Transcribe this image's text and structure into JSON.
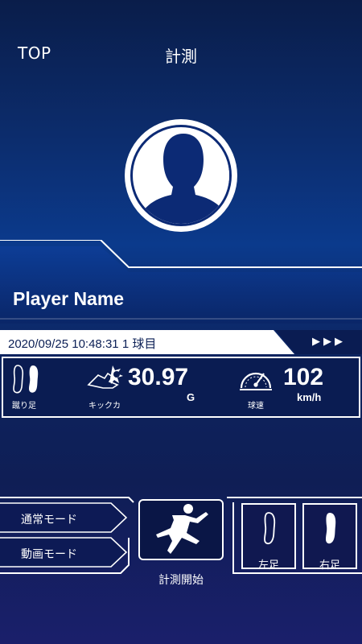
{
  "header": {
    "top_label": "TOP",
    "title": "計測"
  },
  "player": {
    "name": "Player Name"
  },
  "info": {
    "datetime": "2020/09/25 10:48:31",
    "shot": "1 球目",
    "arrows": "▶▶▶"
  },
  "stats": {
    "foot_label": "蹴り足",
    "kick_label": "キックカ",
    "kick_value": "30.97",
    "kick_unit": "G",
    "speed_label": "球速",
    "speed_value": "102",
    "speed_unit": "km/h"
  },
  "modes": {
    "normal": "通常モード",
    "video": "動画モード"
  },
  "start": {
    "label": "計測開始"
  },
  "feet": {
    "left": "左足",
    "right": "右足"
  },
  "colors": {
    "accent": "#0b3a8c",
    "panel": "#0a1c52",
    "white": "#ffffff"
  }
}
